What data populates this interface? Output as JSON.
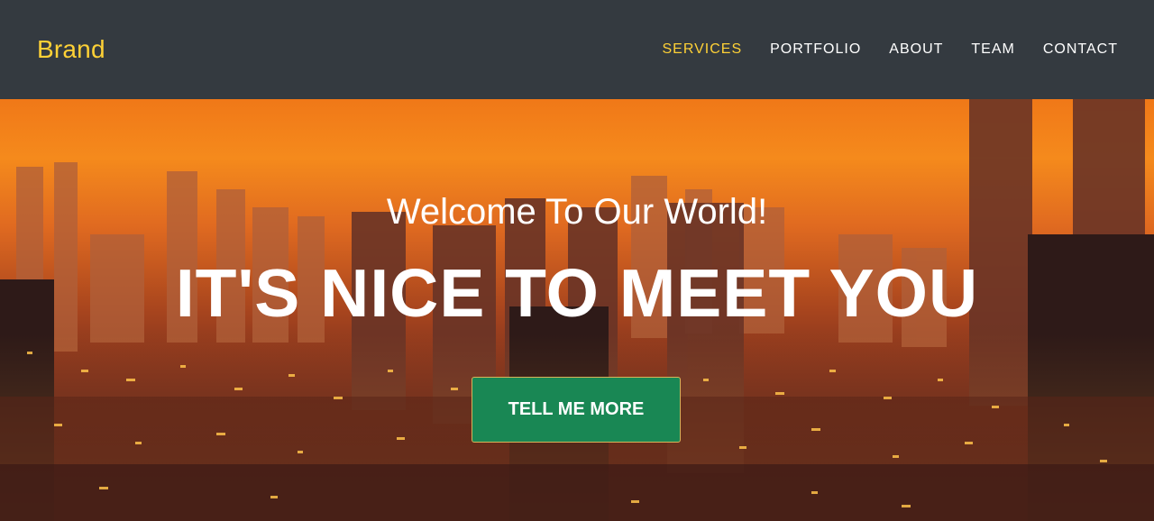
{
  "navbar": {
    "brand": "Brand",
    "items": [
      {
        "label": "SERVICES",
        "active": true
      },
      {
        "label": "PORTFOLIO"
      },
      {
        "label": "ABOUT"
      },
      {
        "label": "TEAM"
      },
      {
        "label": "CONTACT"
      }
    ]
  },
  "hero": {
    "lead": "Welcome To Our World!",
    "heading": "IT'S NICE TO MEET YOU",
    "button_label": "TELL ME MORE"
  },
  "colors": {
    "navbar_bg": "#343a40",
    "accent": "#fed136",
    "button_bg": "#198754"
  }
}
